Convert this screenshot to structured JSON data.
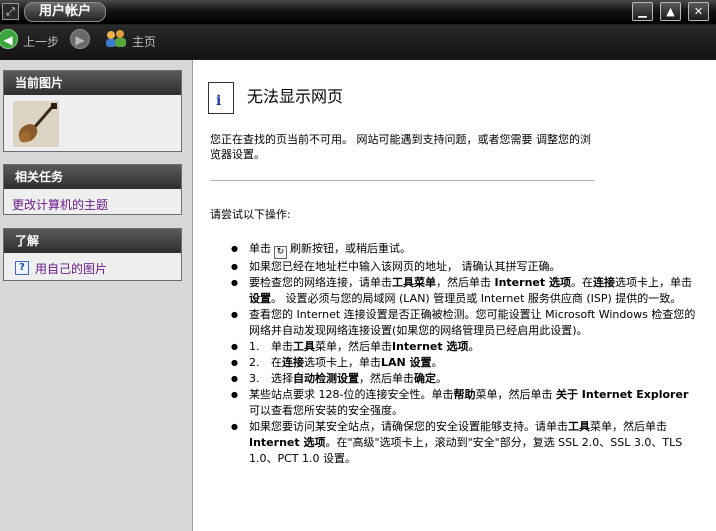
{
  "window": {
    "title": "用户帐户",
    "app_icon": "window-menu-icon",
    "controls": [
      "minimize-icon",
      "maximize-icon",
      "close-icon"
    ]
  },
  "toolbar": {
    "back_label": "上一步",
    "forward_icon": "forward-arrow-icon",
    "home_label": "主页"
  },
  "sidebar": {
    "current_picture": {
      "heading": "当前图片",
      "image": "guitar-picture"
    },
    "related_tasks": {
      "heading": "相关任务",
      "items": [
        "更改计算机的主题"
      ]
    },
    "learn": {
      "heading": "了解",
      "items": [
        "用自己的图片"
      ]
    }
  },
  "content": {
    "title": "无法显示网页",
    "intro": "您正在查找的页当前不可用。 网站可能遇到支持问题，或者您需要 调整您的浏览器设置。",
    "try_heading": "请尝试以下操作:",
    "bullets": {
      "b1_pre": "单击",
      "b1_post": "刷新按钮，或稍后重试。",
      "b2": "如果您已经在地址栏中输入该网页的地址， 请确认其拼写正确。",
      "b3_a": "要检查您的网络连接，请单击",
      "b3_b": "工具菜单",
      "b3_c": "，然后单击 ",
      "b3_d": "Internet 选项",
      "b3_e": "。在",
      "b3_f": "连接",
      "b3_g": "选项卡上，单击",
      "b3_h": "设置",
      "b3_i": "。 设置必须与您的局域网 (LAN) 管理员或 Internet 服务供应商 (ISP) 提供的一致。",
      "b4": "查看您的 Internet 连接设置是否正确被检测。您可能设置让 Microsoft Windows 检查您的网络并自动发现网络连接设置(如果您的网络管理员已经启用此设置)。",
      "s1_a": "单击",
      "s1_b": "工具",
      "s1_c": "菜单，然后单击",
      "s1_d": "Internet 选项",
      "s1_e": "。",
      "s2_a": "在",
      "s2_b": "连接",
      "s2_c": "选项卡上，单击",
      "s2_d": "LAN 设置",
      "s2_e": "。",
      "s3_a": "选择",
      "s3_b": "自动检测设置",
      "s3_c": "，然后单击",
      "s3_d": "确定",
      "s3_e": "。",
      "b5_a": "某些站点要求 128-位的连接安全性。单击",
      "b5_b": "帮助",
      "b5_c": "菜单，然后单击 ",
      "b5_d": "关于 Internet Explorer",
      "b5_e": " 可以查看您所安装的安全强度。",
      "b6_a": "如果您要访问某安全站点，请确保您的安全设置能够支持。请单击",
      "b6_b": "工具",
      "b6_c": "菜单，然后单击 ",
      "b6_d": "Internet 选项",
      "b6_e": "。在\"高级\"选项卡上，滚动到\"安全\"部分，复选 SSL 2.0、SSL 3.0、TLS 1.0、PCT 1.0 设置。"
    },
    "sub_numbers": [
      "1.",
      "2.",
      "3."
    ]
  }
}
